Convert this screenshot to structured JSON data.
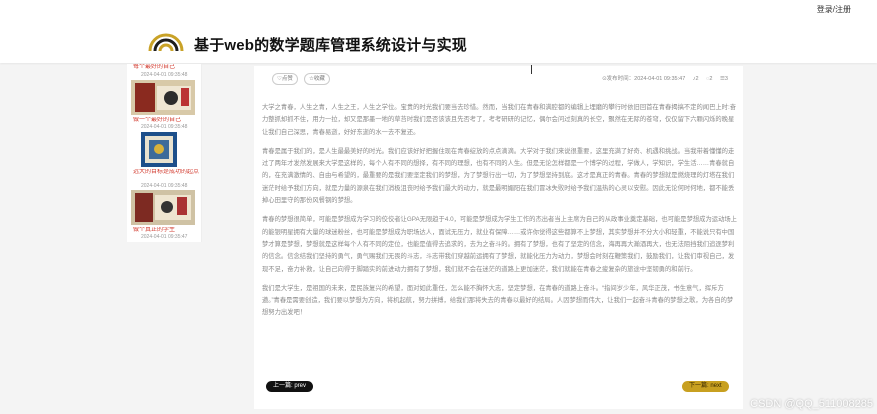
{
  "header": {
    "login_label": "登录/注册",
    "site_title": "基于web的数学题库管理系统设计与实现"
  },
  "sidebar": {
    "items": [
      {
        "title": "每个最好的自己",
        "date": "2024-04-01 09:35:48"
      },
      {
        "title": "做一个最好的自己",
        "date": "2024-04-01 09:35:48"
      },
      {
        "title": "远大的目标是成功的起点",
        "date": "2024-04-01 09:35:48"
      },
      {
        "title": "做个真正的学生",
        "date": "2024-04-01 09:35:47"
      }
    ]
  },
  "article": {
    "like_label": "♡点赞",
    "favorite_label": "☆收藏",
    "publish_time": "⊙发布时间：2024-04-01 09:35:47",
    "likes": "♪2",
    "comments": "◌2",
    "views": "☰3",
    "paragraphs": [
      "大学之青春，人生之青，人生之王，人生之学位。宝贵的时光我们要当去珍惜。然而，当我们在青春和满腔都的编辑上埋磨的攀行时依旧回首在青春揭搞不定的闻巴上时:奋力整抓却抓不住，用力一拉，却又是那墨一地的草苔时我们是否该该且先否考了，考考研研的记忆，偶尔会问过刻真的长空，飘然在无际的苍穹，仅仅留下六颗闪烁的晚星让我们自己深思，青春易逝，好好东逝的水一去不复还。",
      "青春是属于我们的，是人生最最美好的时光。我们应该好好把握住现在青春绽放的点点滴滴。大学对于我们来说很重要，这里充满了好奇、机遇和挑战。当我带着懂懂的走过了两年才发然发展来大学是这样的，每个人有不同的想择，有不同的理想，也有不同的人生。但是无论怎样都是一个博学的过程，学做人，学知识，学生活……青春就自的，在充满激情的、自由与希望的，最重要的是我们要坚定我们的梦想，为了梦想行出一切，为了梦想坚持到底。这才是真正的青春。青春的梦想就是燃烧理的灯塔在我们迷茫时给予我们方向，就是力量的源泉在我们消极沮丧时给予我们最大的动力，就是最明媚阳在我们冒冰失败时给予我们温热的心灵以安慰。因此无论何时何地，都不能丢掉心田里守的那份风餐钢的梦想。",
      "青春的梦想很简单，可能是梦想成为学习的佼佼者让GPA无限趋于4.0，可能是梦想成为学生工作的杰出者当上主席为自己的从政事业奠定基础，也可能是梦想成为运动场上的能银明星拥有大量的球迷粉丝，也可能是梦想成为职场达人，面试无压力，就业有保障……或许你觉得这些都算不上梦想，其实梦想并不分大小和轻重，不能说只有中国梦才算是梦想，梦想就是这样每个人有不同的定位，也能是值得去追求的，去为之奋斗的。拥有了梦想，也有了坚定的信念，海再再大瀚酒再大，也无法阻挡我们追逐梦利的信念。信念结我们坚持的勇气，勇气赐我们无畏的斗志，斗志带我们穿越前运拥有了梦想，就能化压力为动力，梦想会时刻在鞭策我们，鼓励我们，让我们审视自己，发现不足，奋力补救，让自己向得于脚踏实的前进动力拥有了梦想，我们就不会在迷茫的道路上更加迷茫，我们就能在青春之疲复杂的旅途中坚韧勇的和前行。",
      "我们是大学生，是祖国的未来，是民族复兴的希望，面对如此重任，怎么能不胸怀大志，坚定梦想，在青春的道路上奋斗。“指间岁少年，风华正茂，书生意气，挥斥方遒。”青春是需要创造，我们要以梦想为方向，将机起航，努力拼搏，给我们那将失去的青春以最好的结局。人因梦想而伟大，让我们一起奋斗青春的梦想之歌，为各自的梦想努力出发吧！"
    ]
  },
  "navigation": {
    "prev_label": "上一篇: prev",
    "next_label": "下一篇: next"
  },
  "watermark": "CSDN @QQ_511008285"
}
